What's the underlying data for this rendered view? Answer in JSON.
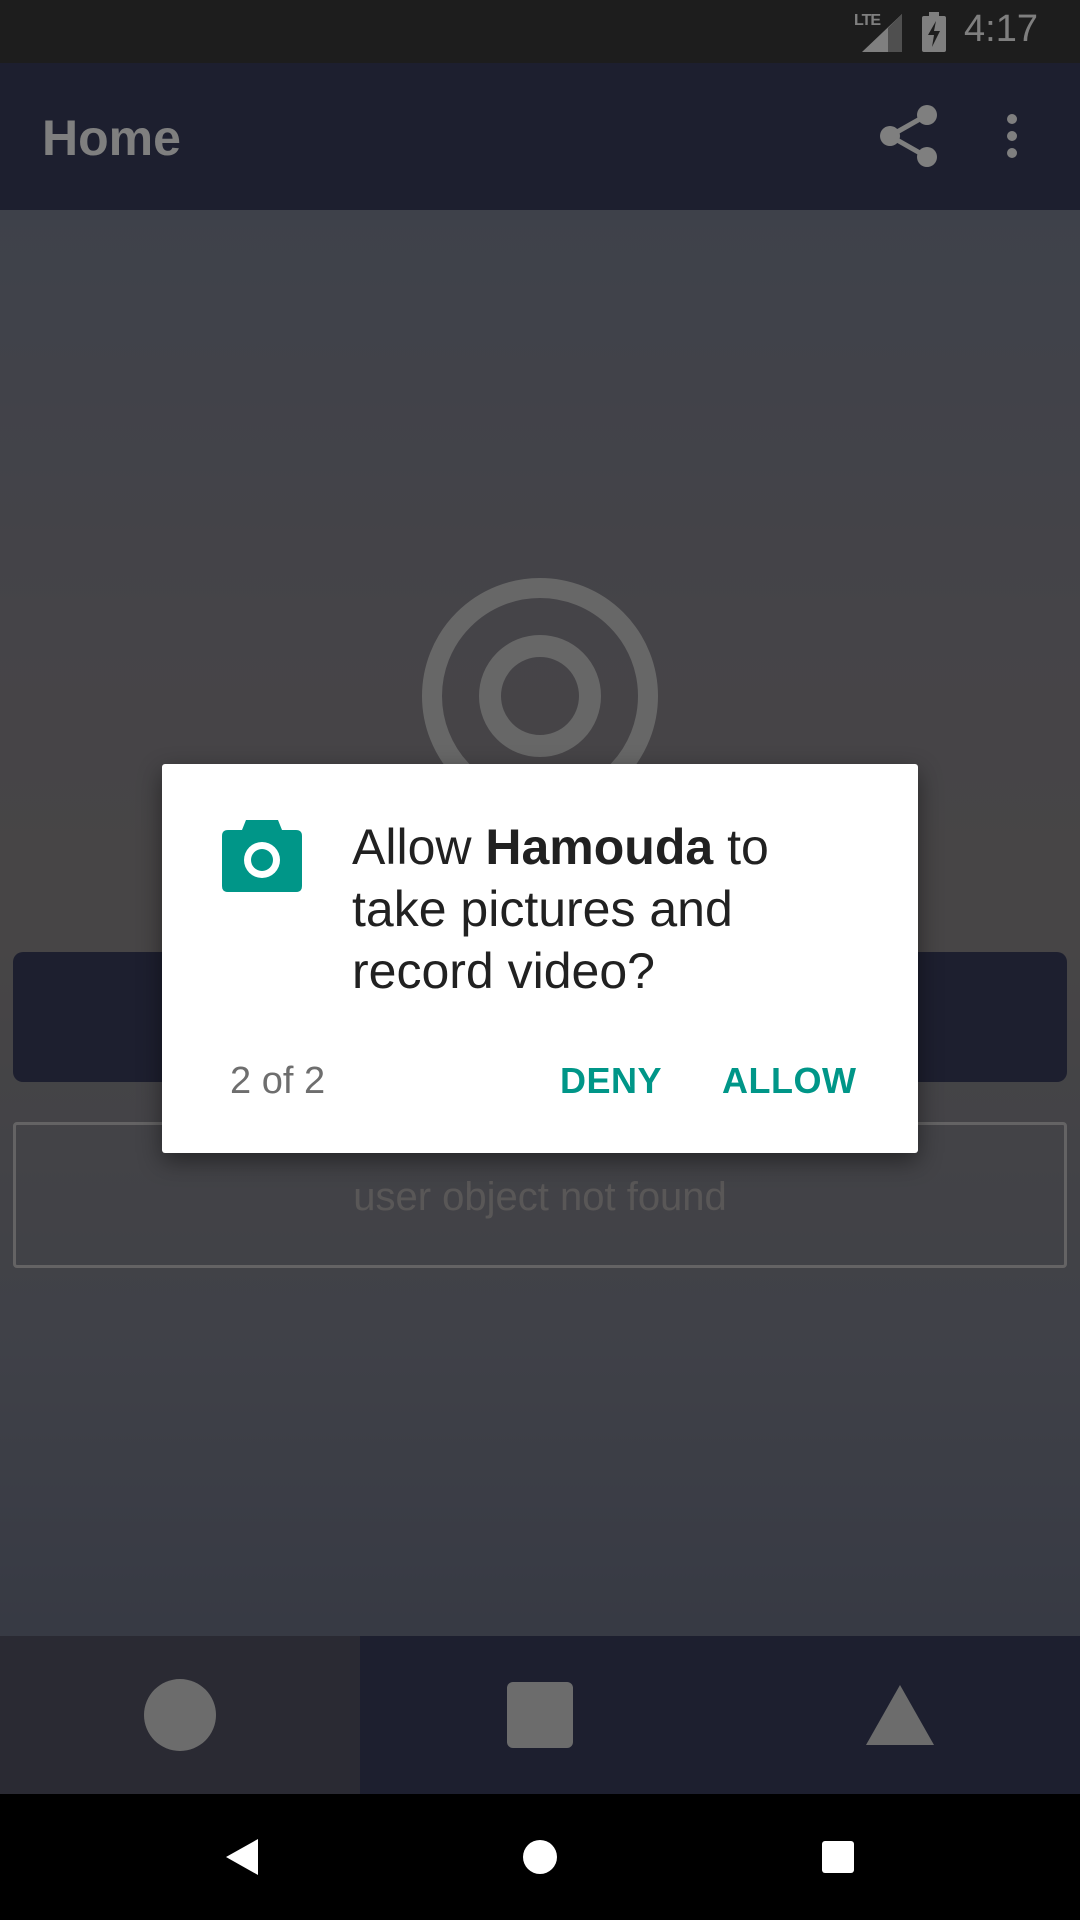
{
  "status_bar": {
    "network": "LTE",
    "time": "4:17"
  },
  "app_bar": {
    "title": "Home",
    "icons": [
      "share-icon",
      "more-vert-icon"
    ]
  },
  "content": {
    "user_field_text": "user object not found"
  },
  "bottom_tabs": [
    {
      "icon": "circle-icon",
      "active": true
    },
    {
      "icon": "square-icon",
      "active": false
    },
    {
      "icon": "triangle-icon",
      "active": false
    }
  ],
  "system_nav": [
    "back-icon",
    "home-icon",
    "recents-icon"
  ],
  "dialog": {
    "icon": "camera-icon",
    "message_prefix": "Allow ",
    "app_name": "Hamouda",
    "message_suffix": " to take pictures and record video?",
    "counter": "2 of 2",
    "deny_label": "DENY",
    "allow_label": "ALLOW"
  },
  "colors": {
    "primary": "#3a3f5e",
    "accent": "#009688",
    "status_bar": "#3a3a3a"
  }
}
